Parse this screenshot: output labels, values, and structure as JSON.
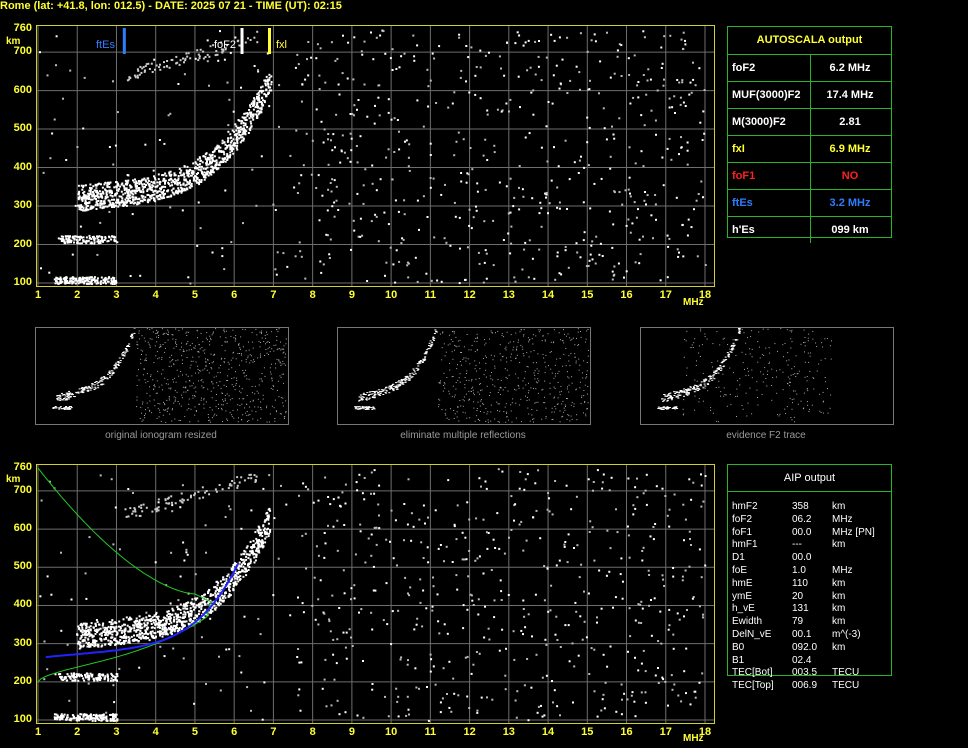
{
  "header": "Rome (lat: +41.8, lon: 012.5) - DATE: 2025 07 21 - TIME (UT): 02:15",
  "axes": {
    "y_unit": "km",
    "x_unit": "MHz",
    "y_ticks": [
      "760",
      "700",
      "600",
      "500",
      "400",
      "300",
      "200",
      "100"
    ],
    "x_ticks": [
      "1",
      "2",
      "3",
      "4",
      "5",
      "6",
      "7",
      "8",
      "9",
      "10",
      "11",
      "12",
      "13",
      "14",
      "15",
      "16",
      "17",
      "18"
    ]
  },
  "markers": {
    "ftEs": {
      "label": "ftEs",
      "freq": 3.2,
      "color": "#2f7dff"
    },
    "foF2": {
      "label": "foF2",
      "freq": 6.2,
      "color": "#ffffff"
    },
    "fxl": {
      "label": "fxl",
      "freq": 6.9,
      "color": "#ffff33"
    }
  },
  "thumbnails": [
    {
      "caption": "original ionogram resized"
    },
    {
      "caption": "eliminate multiple reflections"
    },
    {
      "caption": "evidence F2 trace"
    }
  ],
  "autoscala": {
    "title": "AUTOSCALA output",
    "rows": [
      {
        "key": "foF2",
        "value": "6.2  MHz",
        "key_color": "#ffffff",
        "value_color": "#ffffff"
      },
      {
        "key": "MUF(3000)F2",
        "value": "17.4  MHz",
        "key_color": "#ffffff",
        "value_color": "#ffffff"
      },
      {
        "key": "M(3000)F2",
        "value": "2.81",
        "key_color": "#ffffff",
        "value_color": "#ffffff"
      },
      {
        "key": "fxI",
        "value": "6.9  MHz",
        "key_color": "#ffff33",
        "value_color": "#ffff33"
      },
      {
        "key": "foF1",
        "value": "NO",
        "key_color": "#ff2020",
        "value_color": "#ff2020"
      },
      {
        "key": "ftEs",
        "value": "3.2  MHz",
        "key_color": "#2f7dff",
        "value_color": "#2f7dff"
      },
      {
        "key": "h'Es",
        "value": "099      km",
        "key_color": "#ffffff",
        "value_color": "#ffffff"
      }
    ]
  },
  "aip": {
    "title": "AIP output",
    "rows": [
      {
        "name": "hmF2",
        "value": "358",
        "unit": "km"
      },
      {
        "name": "foF2",
        "value": "06.2",
        "unit": "MHz"
      },
      {
        "name": "foF1",
        "value": "00.0",
        "unit": "MHz    [PN]"
      },
      {
        "name": "hmF1",
        "value": "---",
        "unit": "km"
      },
      {
        "name": "D1",
        "value": "00.0",
        "unit": ""
      },
      {
        "name": "foE",
        "value": "1.0",
        "unit": "MHz"
      },
      {
        "name": "hmE",
        "value": "110",
        "unit": "km"
      },
      {
        "name": "ymE",
        "value": "20",
        "unit": "km"
      },
      {
        "name": "h_vE",
        "value": "131",
        "unit": "km"
      },
      {
        "name": "Ewidth",
        "value": "79",
        "unit": "km"
      },
      {
        "name": "DelN_vE",
        "value": "00.1",
        "unit": "m^(-3)"
      },
      {
        "name": "B0",
        "value": "092.0",
        "unit": "km"
      },
      {
        "name": "B1",
        "value": "02.4",
        "unit": ""
      },
      {
        "name": "TEC[Bot]",
        "value": "003.5",
        "unit": "TECU"
      },
      {
        "name": "TEC[Top]",
        "value": "006.9",
        "unit": "TECU"
      }
    ]
  },
  "colors": {
    "axis_label": "#ffff33",
    "grid": "#6e6e6e",
    "panel_border": "#29b529",
    "profile_curve": "#2222ff",
    "model_curve": "#22cc22"
  }
}
